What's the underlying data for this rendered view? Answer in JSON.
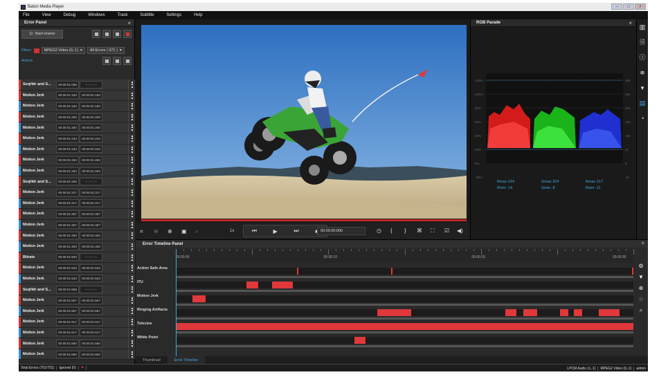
{
  "window": {
    "title": "Baton Media Player",
    "buttons": [
      "–",
      "□",
      "×"
    ]
  },
  "menu": [
    "File",
    "View",
    "Debug",
    "Windows",
    "Track",
    "Subtitle",
    "Settings",
    "Help"
  ],
  "error_panel": {
    "title": "Error Panel",
    "start_review": "Start review",
    "filters_label": "Filters",
    "filter_stream": "MPEG2 Video (0,-1)",
    "filter_errors": "All Errors ( 671 )",
    "actions_label": "Actions",
    "rows": [
      {
        "name": "SeqHdr and S...",
        "start": "00:00:01:058",
        "end": "-- : -- : --",
        "marker": "red"
      },
      {
        "name": "Motion Jerk",
        "start": "00:00:01:150",
        "end": "00:00:01:150",
        "marker": "red"
      },
      {
        "name": "Motion Jerk",
        "start": "00:00:01:150",
        "end": "00:00:01:150",
        "marker": "blue"
      },
      {
        "name": "Motion Jerk",
        "start": "00:00:01:200",
        "end": "00:00:01:200",
        "marker": "red"
      },
      {
        "name": "Motion Jerk",
        "start": "00:00:01:200",
        "end": "00:00:01:200",
        "marker": "blue"
      },
      {
        "name": "Motion Jerk",
        "start": "00:00:01:233",
        "end": "00:00:01:233",
        "marker": "red"
      },
      {
        "name": "Motion Jerk",
        "start": "00:00:01:233",
        "end": "00:00:01:233",
        "marker": "blue"
      },
      {
        "name": "Motion Jerk",
        "start": "00:00:01:283",
        "end": "00:00:01:283",
        "marker": "red"
      },
      {
        "name": "Motion Jerk",
        "start": "00:00:01:283",
        "end": "00:00:01:283",
        "marker": "blue"
      },
      {
        "name": "SeqHdr and S...",
        "start": "00:00:01:308",
        "end": "-- : -- : --",
        "marker": "red"
      },
      {
        "name": "Motion Jerk",
        "start": "00:00:01:317",
        "end": "00:00:01:317",
        "marker": "red"
      },
      {
        "name": "Motion Jerk",
        "start": "00:00:01:317",
        "end": "00:00:01:317",
        "marker": "blue"
      },
      {
        "name": "Motion Jerk",
        "start": "00:00:01:367",
        "end": "00:00:01:367",
        "marker": "red"
      },
      {
        "name": "Motion Jerk",
        "start": "00:00:01:367",
        "end": "00:00:01:367",
        "marker": "blue"
      },
      {
        "name": "Motion Jerk",
        "start": "00:00:01:400",
        "end": "00:00:01:400",
        "marker": "red"
      },
      {
        "name": "Motion Jerk",
        "start": "00:00:01:400",
        "end": "00:00:01:400",
        "marker": "blue"
      },
      {
        "name": "Bitrate",
        "start": "00:00:01:500",
        "end": "-- : -- : --",
        "marker": "red"
      },
      {
        "name": "Motion Jerk",
        "start": "00:00:01:533",
        "end": "00:00:01:533",
        "marker": "red"
      },
      {
        "name": "Motion Jerk",
        "start": "00:00:01:533",
        "end": "00:00:01:533",
        "marker": "blue"
      },
      {
        "name": "SeqHdr and S...",
        "start": "00:00:01:558",
        "end": "-- : -- : --",
        "marker": "red"
      },
      {
        "name": "Motion Jerk",
        "start": "00:00:01:567",
        "end": "00:00:01:567",
        "marker": "red"
      },
      {
        "name": "Motion Jerk",
        "start": "00:00:01:567",
        "end": "00:00:01:567",
        "marker": "blue"
      },
      {
        "name": "Motion Jerk",
        "start": "00:00:01:617",
        "end": "00:00:01:617",
        "marker": "red"
      },
      {
        "name": "Motion Jerk",
        "start": "00:00:01:617",
        "end": "00:00:01:617",
        "marker": "blue"
      },
      {
        "name": "Motion Jerk",
        "start": "00:00:01:650",
        "end": "00:00:01:650",
        "marker": "red"
      },
      {
        "name": "Motion Jerk",
        "start": "00:00:01:650",
        "end": "00:00:01:650",
        "marker": "blue"
      }
    ]
  },
  "player": {
    "speed": "1x",
    "timecode": "00:00:00:000"
  },
  "rgb_parade": {
    "title": "RGB Parade",
    "left_scale": [
      "120%",
      "100%",
      "80%",
      "60%",
      "40%",
      "20%",
      "0%",
      "-20%"
    ],
    "right_scale": [
      "306",
      "255",
      "204",
      "153",
      "102",
      "51",
      "0",
      "-51"
    ],
    "rmax": "Rmax   224",
    "rmin": "Rmin   -14",
    "gmax": "Gmax   224",
    "gmin": "Gmin   -8",
    "bmax": "Bmax   217",
    "bmin": "Bmin   -11"
  },
  "timeline": {
    "title": "Error Timeline Panel",
    "ruler": [
      "00:00:00",
      "00:00:10",
      "00:00:20",
      "00:00:30"
    ],
    "rows": [
      {
        "label": "Action Safe Area",
        "segments": [
          [
            0.265,
            0.003
          ],
          [
            0.47,
            0.003
          ],
          [
            1.0,
            0.003
          ]
        ]
      },
      {
        "label": "ITU",
        "segments": [
          [
            0.155,
            0.025
          ],
          [
            0.21,
            0.045
          ]
        ]
      },
      {
        "label": "Motion Jerk",
        "segments": [
          [
            0.037,
            0.028
          ]
        ]
      },
      {
        "label": "Ringing Artifacts",
        "segments": [
          [
            0.44,
            0.075
          ],
          [
            0.72,
            0.025
          ],
          [
            0.76,
            0.03
          ],
          [
            0.84,
            0.018
          ],
          [
            0.87,
            0.018
          ],
          [
            0.925,
            0.045
          ]
        ]
      },
      {
        "label": "Telecine",
        "segments": [
          [
            0.0,
            1.0
          ]
        ]
      },
      {
        "label": "White Point",
        "segments": [
          [
            0.39,
            0.025
          ]
        ]
      }
    ],
    "tabs": [
      "Thumbnail",
      "Error Timeline"
    ]
  },
  "status": {
    "total": "Total Errors (701/701)",
    "ignored": "Ignored (0)",
    "audio": "LPCM Audio (1,-1)",
    "video": "MPEG2 Video (0,-1)",
    "user": "admin"
  },
  "colors": {
    "accent": "#3fa9e0",
    "error": "#e0383b"
  }
}
